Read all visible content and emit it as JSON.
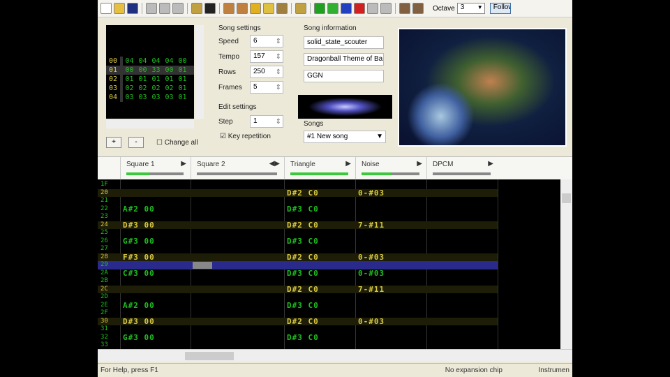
{
  "toolbar": {
    "octave_label": "Octave",
    "octave_value": "3",
    "follow_label": "Follow"
  },
  "frames": {
    "rows": [
      {
        "n": "00",
        "v": [
          "04",
          "04",
          "04",
          "04",
          "00"
        ]
      },
      {
        "n": "01",
        "v": [
          "00",
          "00",
          "33",
          "00",
          "01"
        ]
      },
      {
        "n": "02",
        "v": [
          "01",
          "01",
          "01",
          "01",
          "01"
        ]
      },
      {
        "n": "03",
        "v": [
          "02",
          "02",
          "02",
          "02",
          "01"
        ]
      },
      {
        "n": "04",
        "v": [
          "03",
          "03",
          "03",
          "03",
          "01"
        ]
      }
    ],
    "add": "+",
    "remove": "-",
    "change_all": "Change all"
  },
  "song_settings": {
    "title": "Song settings",
    "speed_label": "Speed",
    "speed": "6",
    "tempo_label": "Tempo",
    "tempo": "157",
    "rows_label": "Rows",
    "rows": "250",
    "frames_label": "Frames",
    "frames": "5"
  },
  "edit_settings": {
    "title": "Edit settings",
    "step_label": "Step",
    "step": "1",
    "key_repetition": "Key repetition"
  },
  "song_info": {
    "title": "Song information",
    "name": "solid_state_scouter",
    "artist": "Dragonball Theme of Bar",
    "copyright": "GGN"
  },
  "songs": {
    "label": "Songs",
    "selected": "#1 New song"
  },
  "channels": [
    {
      "name": "Square 1",
      "vol": 40
    },
    {
      "name": "Square 2",
      "vol": 0
    },
    {
      "name": "Triangle",
      "vol": 100
    },
    {
      "name": "Noise",
      "vol": 50
    },
    {
      "name": "DPCM",
      "vol": 0
    }
  ],
  "pattern": {
    "rows": [
      {
        "n": "1F",
        "c": [
          "",
          "",
          "",
          "",
          ""
        ]
      },
      {
        "n": "20",
        "c": [
          "",
          "",
          "D#2 C0",
          "0-#03",
          ""
        ]
      },
      {
        "n": "21",
        "c": [
          "",
          "",
          "",
          "",
          ""
        ]
      },
      {
        "n": "22",
        "c": [
          "A#2 00",
          "",
          "D#3 C0",
          "",
          ""
        ]
      },
      {
        "n": "23",
        "c": [
          "",
          "",
          "",
          "",
          ""
        ]
      },
      {
        "n": "24",
        "c": [
          "D#3 00",
          "",
          "D#2 C0",
          "7-#11",
          ""
        ]
      },
      {
        "n": "25",
        "c": [
          "",
          "",
          "",
          "",
          ""
        ]
      },
      {
        "n": "26",
        "c": [
          "G#3 00",
          "",
          "D#3 C0",
          "",
          ""
        ]
      },
      {
        "n": "27",
        "c": [
          "",
          "",
          "",
          "",
          ""
        ]
      },
      {
        "n": "28",
        "c": [
          "F#3 00",
          "",
          "D#2 C0",
          "0-#03",
          ""
        ]
      },
      {
        "n": "29",
        "c": [
          "",
          "",
          "",
          "",
          ""
        ]
      },
      {
        "n": "2A",
        "c": [
          "C#3 00",
          "",
          "D#3 C0",
          "0-#03",
          ""
        ]
      },
      {
        "n": "2B",
        "c": [
          "",
          "",
          "",
          "",
          ""
        ]
      },
      {
        "n": "2C",
        "c": [
          "",
          "",
          "D#2 C0",
          "7-#11",
          ""
        ]
      },
      {
        "n": "2D",
        "c": [
          "",
          "",
          "",
          "",
          ""
        ]
      },
      {
        "n": "2E",
        "c": [
          "A#2 00",
          "",
          "D#3 C0",
          "",
          ""
        ]
      },
      {
        "n": "2F",
        "c": [
          "",
          "",
          "",
          "",
          ""
        ]
      },
      {
        "n": "30",
        "c": [
          "D#3 00",
          "",
          "D#2 C0",
          "0-#03",
          ""
        ]
      },
      {
        "n": "31",
        "c": [
          "",
          "",
          "",
          "",
          ""
        ]
      },
      {
        "n": "32",
        "c": [
          "G#3 00",
          "",
          "D#3 C0",
          "",
          ""
        ]
      },
      {
        "n": "33",
        "c": [
          "",
          "",
          "",
          "",
          ""
        ]
      }
    ]
  },
  "status": {
    "help": "For Help, press F1",
    "expansion": "No expansion chip",
    "instrument": "Instrumen"
  }
}
